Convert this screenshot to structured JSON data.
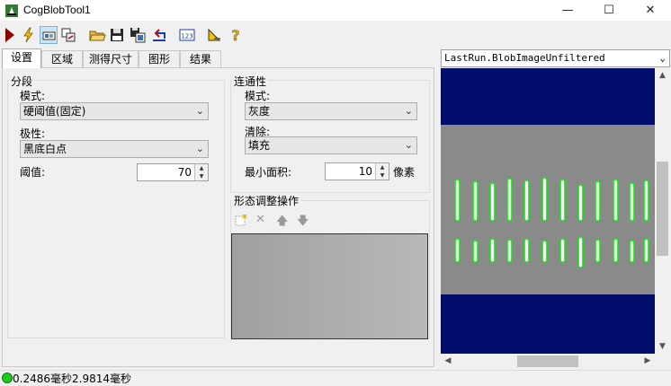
{
  "window": {
    "title": "CogBlobTool1",
    "controls": {
      "minimize": "—",
      "maximize": "☐",
      "close": "✕"
    }
  },
  "toolbar": {
    "icons": [
      "run-icon",
      "electric-icon",
      "show-image-icon",
      "image-source-icon",
      "open-folder-icon",
      "save-icon",
      "save-as-icon",
      "reset-icon",
      "results-123-icon",
      "measure-icon",
      "help-icon"
    ]
  },
  "tabs": [
    "设置",
    "区域",
    "测得尺寸",
    "图形",
    "结果"
  ],
  "segmentation": {
    "title": "分段",
    "mode_label": "模式:",
    "mode_value": "硬阈值(固定)",
    "polarity_label": "极性:",
    "polarity_value": "黑底白点",
    "threshold_label": "阈值:",
    "threshold_value": "70"
  },
  "connectivity": {
    "title": "连通性",
    "mode_label": "模式:",
    "mode_value": "灰度",
    "clear_label": "清除:",
    "clear_value": "填充",
    "min_area_label": "最小面积:",
    "min_area_value": "10",
    "min_area_unit": "像素"
  },
  "morphology": {
    "title": "形态调整操作",
    "toolbar_icons": [
      "add-operation-icon",
      "delete-operation-icon",
      "move-up-icon",
      "move-down-icon"
    ]
  },
  "image_panel": {
    "selected_image": "LastRun.BlobImageUnfiltered"
  },
  "status": {
    "indicator_color": "#1ec81e",
    "text": "0.2486毫秒2.9814毫秒"
  },
  "colors": {
    "image_background": "#000d6b",
    "image_band": "#8a8a8a",
    "blob_outline": "#19e119"
  }
}
